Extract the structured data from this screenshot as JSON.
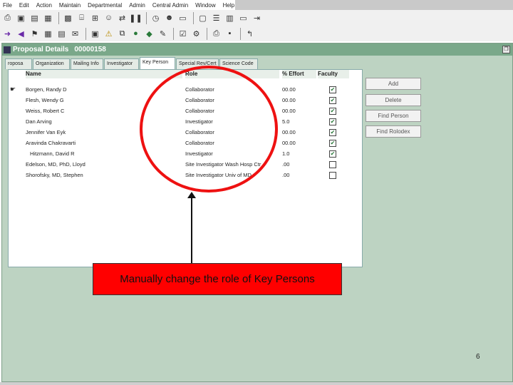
{
  "menu": [
    "File",
    "Edit",
    "Action",
    "Maintain",
    "Departmental",
    "Admin",
    "Central Admin",
    "Window",
    "Help"
  ],
  "toolbar1_icons": [
    "print-icon",
    "save-icon",
    "proposal-icon",
    "budget-icon",
    "grid-icon",
    "tree-icon",
    "hierarchy-icon",
    "people-icon",
    "transfer-icon",
    "pause-icon",
    "clock-icon",
    "user-icon",
    "drive-icon",
    "document-icon",
    "list-icon",
    "columns-icon",
    "window-icon",
    "exit-icon"
  ],
  "toolbar2_icons": [
    "forward-icon",
    "back-icon",
    "flag-icon",
    "table-icon",
    "calendar-icon",
    "mail-icon",
    "notes-icon",
    "warning-icon",
    "copy-icon",
    "coins-icon",
    "tag-icon",
    "edit-icon",
    "checklist-icon",
    "routing-icon",
    "printer-icon",
    "disk-icon",
    "close-icon"
  ],
  "window": {
    "title": "Proposal Details",
    "number": "00000158"
  },
  "tabs": [
    {
      "label": "roposa",
      "active": false
    },
    {
      "label": "Organization",
      "active": false
    },
    {
      "label": "Mailing Info",
      "active": false
    },
    {
      "label": "Investigator",
      "active": false
    },
    {
      "label": "Key Person",
      "active": true
    },
    {
      "label": "Special Rev/Cert",
      "active": false
    },
    {
      "label": "Science Code",
      "active": false
    }
  ],
  "table": {
    "headers": {
      "name": "Name",
      "role": "Role",
      "effort": "% Effort",
      "faculty": "Faculty"
    },
    "rows": [
      {
        "name": "Borgen, Randy D",
        "role": "Collaborator",
        "effort": "00.00",
        "faculty": true
      },
      {
        "name": "Flesh, Wendy G",
        "role": "Collaborator",
        "effort": "00.00",
        "faculty": true
      },
      {
        "name": "Weiss, Robert C",
        "role": "Collaborator",
        "effort": "00.00",
        "faculty": true
      },
      {
        "name": "Dan Arving",
        "role": "Investigator",
        "effort": "5.0",
        "faculty": true
      },
      {
        "name": "Jennifer Van Eyk",
        "role": "Collaborator",
        "effort": "00.00",
        "faculty": true
      },
      {
        "name": "Aravinda Chakravarti",
        "role": "Collaborator",
        "effort": "00.00",
        "faculty": true
      },
      {
        "name": "Hitzmann, David R",
        "role": "Investigator",
        "effort": "1.0",
        "faculty": true
      },
      {
        "name": "Edelson, MD, PhD, Lloyd",
        "role": "Site Investigator Wash Hosp Ctr",
        "effort": ".00",
        "faculty": false
      },
      {
        "name": "Shorofsky, MD, Stephen",
        "role": "Site Investigator Univ of MD",
        "effort": ".00",
        "faculty": false
      }
    ]
  },
  "buttons": {
    "add": "Add",
    "delete": "Delete",
    "find_person": "Find Person",
    "find_rolodex": "Find Rolodex"
  },
  "callout": "Manually change the role of Key Persons",
  "page_number": "6",
  "colors": {
    "highlight_oval": "#ee1111",
    "callout_bg": "#ff0000",
    "titlebar": "#7aa88a",
    "window_bg": "#bdd3c2"
  }
}
